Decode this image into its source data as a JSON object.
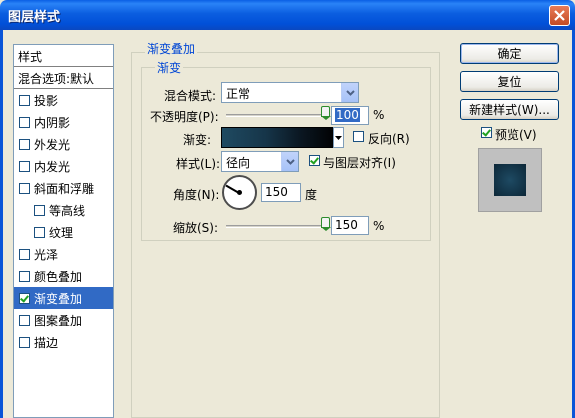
{
  "window": {
    "title": "图层样式"
  },
  "left_panel": {
    "header": "样式",
    "blend": "混合选项:默认",
    "items": [
      {
        "label": "投影",
        "checked": false,
        "sub": false,
        "active": false
      },
      {
        "label": "内阴影",
        "checked": false,
        "sub": false,
        "active": false
      },
      {
        "label": "外发光",
        "checked": false,
        "sub": false,
        "active": false
      },
      {
        "label": "内发光",
        "checked": false,
        "sub": false,
        "active": false
      },
      {
        "label": "斜面和浮雕",
        "checked": false,
        "sub": false,
        "active": false
      },
      {
        "label": "等高线",
        "checked": false,
        "sub": true,
        "active": false
      },
      {
        "label": "纹理",
        "checked": false,
        "sub": true,
        "active": false
      },
      {
        "label": "光泽",
        "checked": false,
        "sub": false,
        "active": false
      },
      {
        "label": "颜色叠加",
        "checked": false,
        "sub": false,
        "active": false
      },
      {
        "label": "渐变叠加",
        "checked": true,
        "sub": false,
        "active": true
      },
      {
        "label": "图案叠加",
        "checked": false,
        "sub": false,
        "active": false
      },
      {
        "label": "描边",
        "checked": false,
        "sub": false,
        "active": false
      }
    ]
  },
  "gradient_overlay": {
    "group_title": "渐变叠加",
    "subgroup_title": "渐变",
    "blend_mode_label": "混合模式:",
    "blend_mode_value": "正常",
    "opacity_label": "不透明度(P):",
    "opacity_value": "100",
    "opacity_unit": "%",
    "opacity_level": 1.0,
    "gradient_label": "渐变:",
    "reverse_label": "反向(R)",
    "reverse_checked": false,
    "style_label": "样式(L):",
    "style_value": "径向",
    "align_label": "与图层对齐(I)",
    "align_checked": true,
    "angle_label": "角度(N):",
    "angle_value": "150",
    "angle_unit": "度",
    "scale_label": "缩放(S):",
    "scale_value": "150",
    "scale_unit": "%",
    "scale_level": 1.0
  },
  "buttons": {
    "ok": "确定",
    "reset": "复位",
    "new_style": "新建样式(W)...",
    "preview_label": "预览(V)",
    "preview_checked": true
  }
}
